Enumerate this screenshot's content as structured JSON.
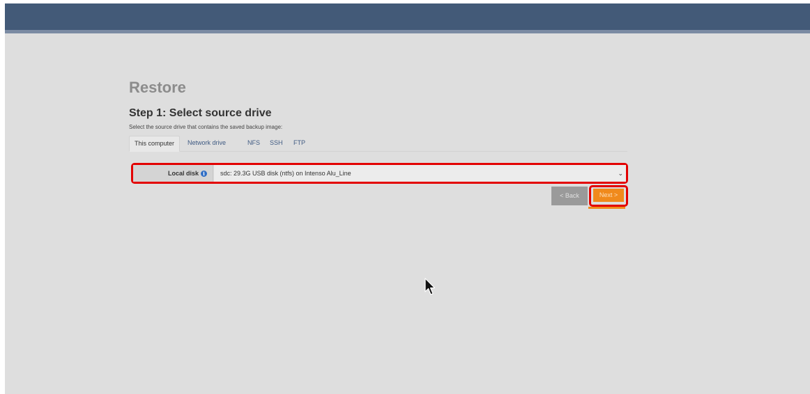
{
  "page": {
    "title": "Restore",
    "step_title": "Step 1: Select source drive",
    "step_description": "Select the source drive that contains the saved backup image:"
  },
  "tabs": [
    {
      "label": "This computer",
      "active": true
    },
    {
      "label": "Network drive",
      "active": false
    },
    {
      "label": "NFS",
      "active": false
    },
    {
      "label": "SSH",
      "active": false
    },
    {
      "label": "FTP",
      "active": false
    }
  ],
  "drive": {
    "label": "Local disk",
    "info_icon": "info-circle-icon",
    "selected": "sdc: 29.3G USB disk (ntfs) on Intenso Alu_Line"
  },
  "buttons": {
    "back": "< Back",
    "next": "Next >"
  },
  "colors": {
    "header": "#435a78",
    "background": "#dedede",
    "next_button": "#f08a1c",
    "back_button": "#9a9a9a",
    "highlight": "#e30000"
  }
}
